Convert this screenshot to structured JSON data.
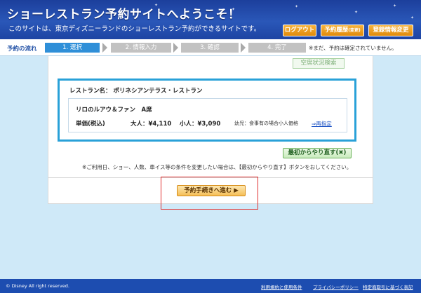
{
  "header": {
    "title": "ショーレストラン予約サイトへようこそ！",
    "subtitle": "このサイトは、東京ディズニーランドのショーレストラン予約ができるサイトです。",
    "logout": "ログアウト",
    "history_main": "予約履歴",
    "history_sub": "(変更)",
    "registration": "登録情報変更"
  },
  "flow": {
    "label": "予約の流れ",
    "steps": [
      "1. 選択",
      "2. 情報入力",
      "3. 確認",
      "4. 完了"
    ],
    "active_step": 1,
    "note": "※まだ、予約は確定されていません。"
  },
  "content": {
    "vacancy_button": "空席状況検索",
    "restaurant_label": "レストラン名：",
    "restaurant_name": "ポリネシアンテラス・レストラン",
    "show_name": "リロのルアウ＆ファン　A席",
    "price_label": "単価(税込)",
    "price_adult": "大人：¥4,110",
    "price_child": "小人：¥3,090",
    "price_note": "幼児：食事有の場合小人価格",
    "respecify_link": "⇒再指定",
    "restart_button": "最初からやり直す(✖)",
    "restart_note": "※ご利用日、ショー、人数、車イス等の条件を変更したい場合は、【最初からやり直す】ボタンをおしてください。",
    "proceed_button": "予約手続きへ進む ▶"
  },
  "footer": {
    "copyright": "© Disney All right reserved.",
    "links": [
      "利用規約と使用条件",
      "プライバシーポリシー",
      "特定商取引に基づく表記"
    ]
  },
  "colors": {
    "header_bg": "#1d44a3",
    "accent_orange": "#e08a0b",
    "step_active": "#2f8fd8",
    "step_inactive": "#c2c2c2",
    "info_border": "#29a1d8",
    "highlight_red": "#e03030",
    "page_bg": "#cfe9f8"
  }
}
